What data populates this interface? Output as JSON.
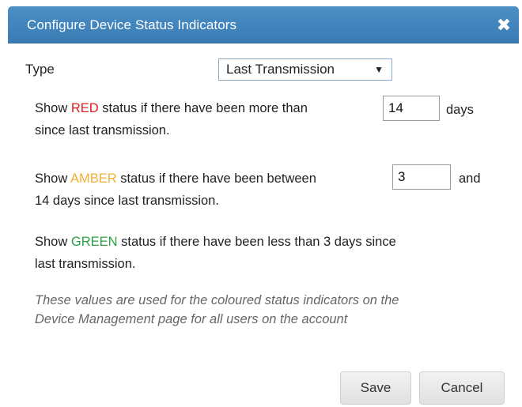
{
  "dialog": {
    "title": "Configure Device Status Indicators",
    "close_glyph": "✖",
    "close_icon": "close-icon"
  },
  "type": {
    "label": "Type",
    "selected": "Last Transmission",
    "arrow_glyph": "▼"
  },
  "red_rule": {
    "prefix": "Show ",
    "color_word": "RED",
    "middle": " status if there have been more than",
    "value": "14",
    "suffix_same_line": "days",
    "suffix_next_line": "since last transmission.",
    "color": "#e02020"
  },
  "amber_rule": {
    "prefix": "Show ",
    "color_word": "AMBER",
    "middle": " status if there have been between",
    "value": "3",
    "suffix_same_line": "and",
    "suffix_next_line": "14 days since last transmission.",
    "color": "#f2b134"
  },
  "green_rule": {
    "prefix": "Show ",
    "color_word": "GREEN",
    "line1_rest": " status if there have been less than 3 days since",
    "line2": "last transmission.",
    "color": "#2ea043"
  },
  "note": {
    "line1": "These values are used for the coloured status indicators on the",
    "line2": "Device Management page for all users on the account"
  },
  "buttons": {
    "save": "Save",
    "cancel": "Cancel"
  },
  "colors": {
    "titlebar": "#3f84bb",
    "title_text": "#ffffff",
    "note_text": "#666666"
  }
}
